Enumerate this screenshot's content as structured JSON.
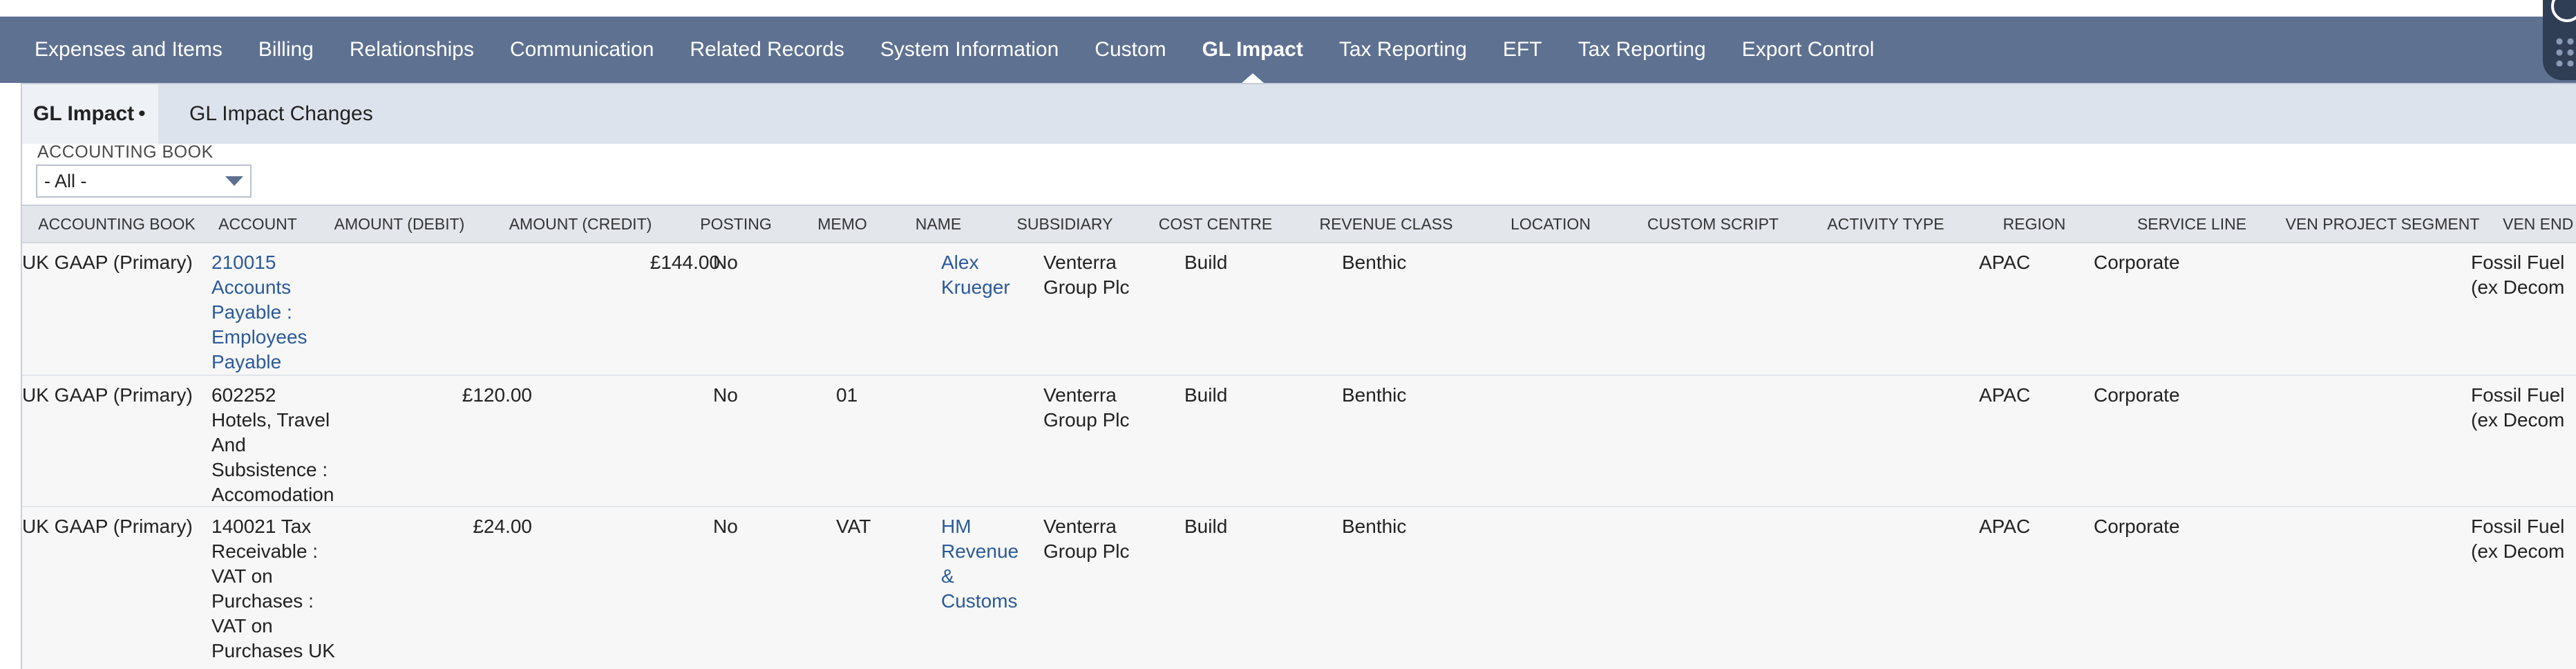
{
  "tabs": [
    {
      "label": "Expenses and Items",
      "active": false
    },
    {
      "label": "Billing",
      "active": false
    },
    {
      "label": "Relationships",
      "active": false
    },
    {
      "label": "Communication",
      "active": false
    },
    {
      "label": "Related Records",
      "active": false
    },
    {
      "label": "System Information",
      "active": false
    },
    {
      "label": "Custom",
      "active": false
    },
    {
      "label": "GL Impact",
      "active": true
    },
    {
      "label": "Tax Reporting",
      "active": false
    },
    {
      "label": "EFT",
      "active": false
    },
    {
      "label": "Tax Reporting",
      "active": false
    },
    {
      "label": "Export Control",
      "active": false
    }
  ],
  "subtabs": {
    "gl_impact": "GL Impact",
    "gl_impact_marker": "•",
    "gl_impact_changes": "GL Impact Changes"
  },
  "filter": {
    "label": "ACCOUNTING BOOK",
    "value": "- All -"
  },
  "table": {
    "columns": {
      "accounting_book": "ACCOUNTING BOOK",
      "account": "ACCOUNT",
      "amount_debit": "AMOUNT (DEBIT)",
      "amount_credit": "AMOUNT (CREDIT)",
      "posting": "POSTING",
      "memo": "MEMO",
      "name": "NAME",
      "subsidiary": "SUBSIDIARY",
      "cost_centre": "COST CENTRE",
      "revenue_class": "REVENUE CLASS",
      "location": "LOCATION",
      "custom_script": "CUSTOM SCRIPT",
      "activity_type": "ACTIVITY TYPE",
      "region": "REGION",
      "service_line": "SERVICE LINE",
      "ven_project_segment": "VEN PROJECT SEGMENT",
      "ven_end": "VEN END S"
    },
    "rows": [
      {
        "accounting_book": "UK GAAP (Primary)",
        "account_lines": [
          "210015",
          "Accounts",
          "Payable :",
          "Employees",
          "Payable"
        ],
        "account_is_link": true,
        "amount_debit": "",
        "amount_credit": "£144.00",
        "posting": "No",
        "memo": "",
        "name_lines": [
          "Alex",
          "Krueger"
        ],
        "subsidiary_lines": [
          "Venterra",
          "Group Plc"
        ],
        "cost_centre": "Build",
        "revenue_class": "Benthic",
        "location": "",
        "custom_script": "",
        "activity_type": "",
        "region": "APAC",
        "service_line": "Corporate",
        "ven_project_segment": "",
        "ven_end_lines": [
          "Fossil Fuel",
          "(ex Decom"
        ]
      },
      {
        "accounting_book": "UK GAAP (Primary)",
        "account_lines": [
          "602252",
          "Hotels, Travel",
          "And",
          "Subsistence :",
          "Accomodation"
        ],
        "account_is_link": false,
        "amount_debit": "£120.00",
        "amount_credit": "",
        "posting": "No",
        "memo": "01",
        "name_lines": [],
        "subsidiary_lines": [
          "Venterra",
          "Group Plc"
        ],
        "cost_centre": "Build",
        "revenue_class": "Benthic",
        "location": "",
        "custom_script": "",
        "activity_type": "",
        "region": "APAC",
        "service_line": "Corporate",
        "ven_project_segment": "",
        "ven_end_lines": [
          "Fossil Fuel",
          "(ex Decom"
        ]
      },
      {
        "accounting_book": "UK GAAP (Primary)",
        "account_lines": [
          "140021 Tax",
          "Receivable :",
          "VAT on",
          "Purchases :",
          "VAT on",
          "Purchases UK"
        ],
        "account_is_link": false,
        "amount_debit": "£24.00",
        "amount_credit": "",
        "posting": "No",
        "memo": "VAT",
        "name_lines": [
          "HM",
          "Revenue",
          "&",
          "Customs"
        ],
        "subsidiary_lines": [
          "Venterra",
          "Group Plc"
        ],
        "cost_centre": "Build",
        "revenue_class": "Benthic",
        "location": "",
        "custom_script": "",
        "activity_type": "",
        "region": "APAC",
        "service_line": "Corporate",
        "ven_project_segment": "",
        "ven_end_lines": [
          "Fossil Fuel",
          "(ex Decom"
        ]
      }
    ]
  },
  "colors": {
    "tabbar": "#5f7191",
    "link": "#2a5a9a",
    "header_bg": "#e3e6eb"
  }
}
